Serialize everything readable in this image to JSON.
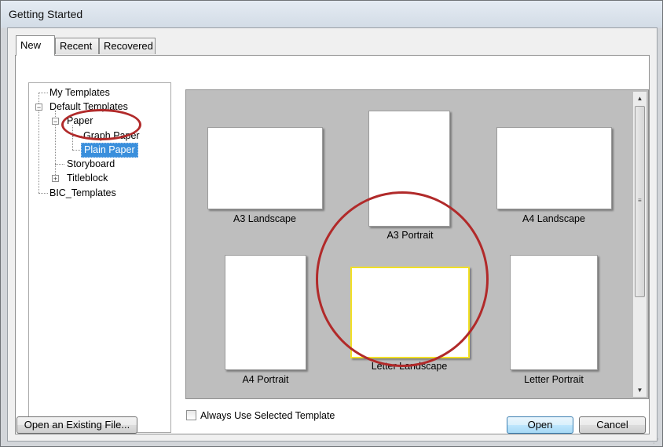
{
  "window": {
    "title": "Getting Started"
  },
  "tabs": [
    {
      "label": "New",
      "active": true
    },
    {
      "label": "Recent",
      "active": false
    },
    {
      "label": "Recovered",
      "active": false
    }
  ],
  "tree": {
    "my_templates": "My Templates",
    "default_templates": "Default Templates",
    "paper": "Paper",
    "graph_paper": "Graph Paper",
    "plain_paper": "Plain Paper",
    "storyboard": "Storyboard",
    "titleblock": "Titleblock",
    "bic_templates": "BIC_Templates",
    "expander_open": "−",
    "expander_closed": "+"
  },
  "templates": [
    {
      "label": "A3 Landscape",
      "selected": false
    },
    {
      "label": "A3 Portrait",
      "selected": false
    },
    {
      "label": "A4 Landscape",
      "selected": false
    },
    {
      "label": "A4 Portrait",
      "selected": false
    },
    {
      "label": "Letter Landscape",
      "selected": true
    },
    {
      "label": "Letter Portrait",
      "selected": false
    }
  ],
  "scrollbar": {
    "up": "▲",
    "down": "▼",
    "grip": "≡"
  },
  "options": {
    "always_use_label": "Always Use Selected Template",
    "always_use_checked": false
  },
  "buttons": {
    "open_existing": "Open an Existing File...",
    "open": "Open",
    "cancel": "Cancel"
  },
  "colors": {
    "selection": "#3a8fdc",
    "highlight_border": "#f2e025",
    "annotation": "#b12a2a"
  }
}
